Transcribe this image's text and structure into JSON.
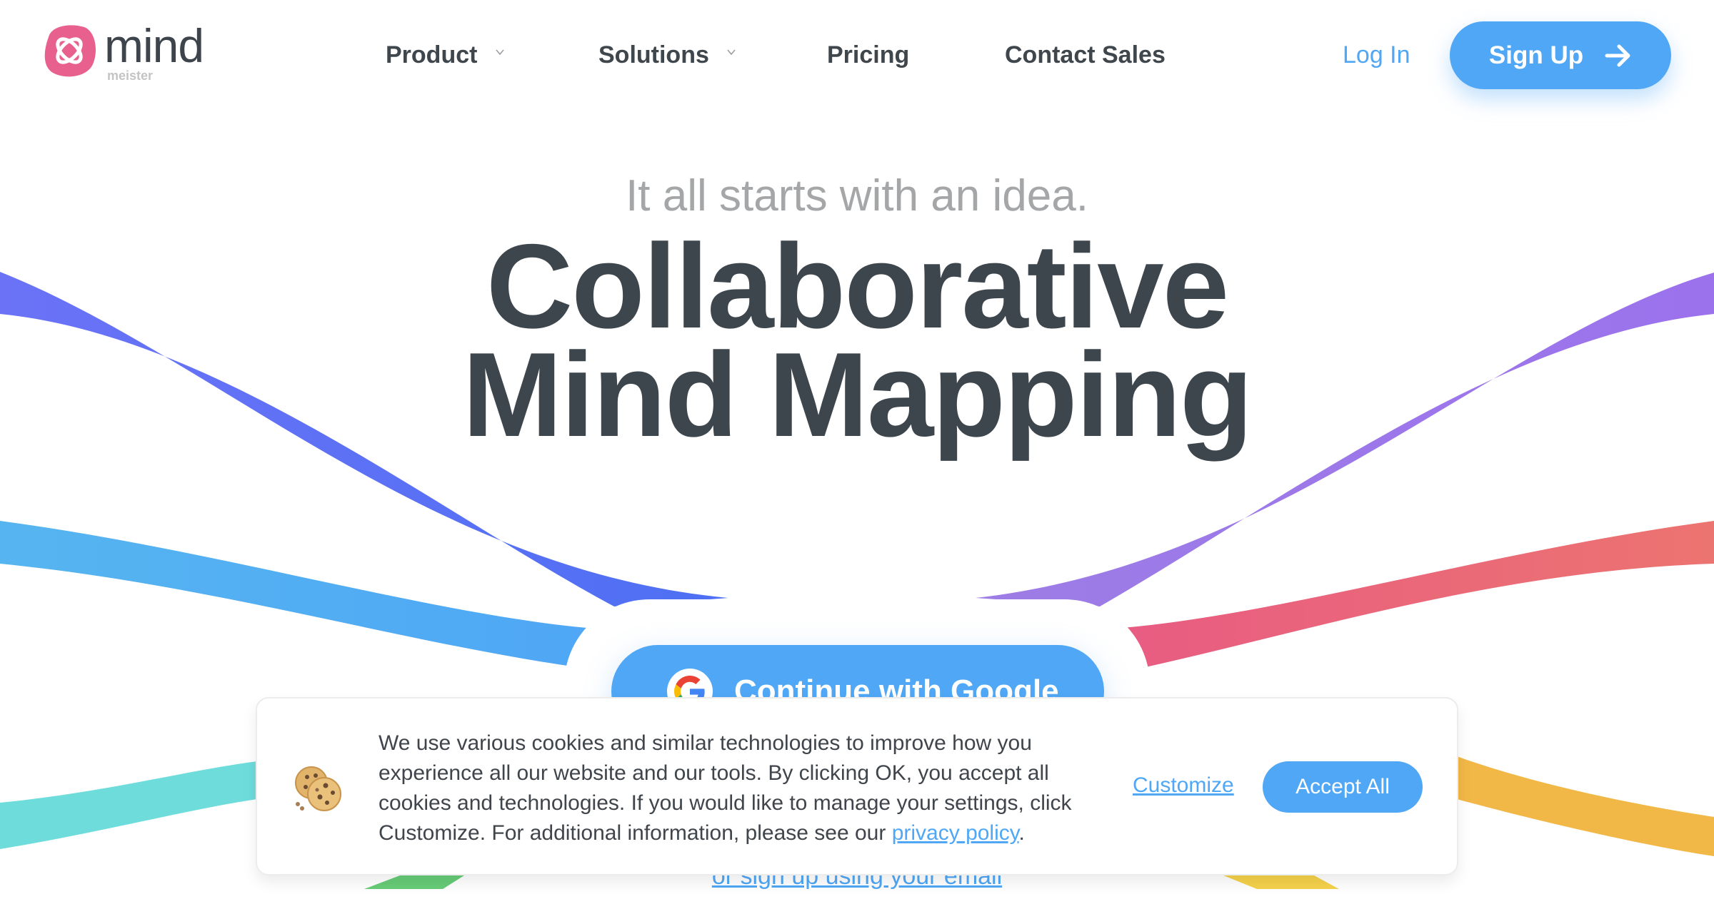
{
  "brand": {
    "name": "mind",
    "sub": "meister",
    "logo_color": "#e8608e"
  },
  "nav": {
    "items": [
      {
        "label": "Product",
        "has_dropdown": true
      },
      {
        "label": "Solutions",
        "has_dropdown": true
      },
      {
        "label": "Pricing",
        "has_dropdown": false
      },
      {
        "label": "Contact Sales",
        "has_dropdown": false
      }
    ],
    "login_label": "Log In",
    "signup_label": "Sign Up",
    "signup_icon": "arrow-right-icon"
  },
  "hero": {
    "tagline": "It all starts with an idea.",
    "headline_line1": "Collaborative",
    "headline_line2": "Mind Mapping",
    "google_button_label": "Continue with Google",
    "google_icon": "google-g-icon",
    "email_link_label": "or sign up using your email"
  },
  "cookie_banner": {
    "icon": "cookie-icon",
    "text_before_link": "We use various cookies and similar technologies to improve how you experience all our website and our tools. By clicking OK, you accept all cookies and technologies. If you would like to manage your settings, click Customize. For additional information, please see our ",
    "link_label": "privacy policy",
    "text_after_link": ".",
    "customize_label": "Customize",
    "accept_label": "Accept All"
  },
  "colors": {
    "accent": "#4fa7f5",
    "text_dark": "#3e464d",
    "tagline_gray": "#a4a6a8",
    "ribbon_indigo": "#5a6ff5",
    "ribbon_sky": "#52adf2",
    "ribbon_purple": "#9b78e8",
    "ribbon_coral": "#ea5f80",
    "ribbon_teal": "#6fdcdc",
    "ribbon_orange": "#f2b847",
    "ribbon_green": "#66cc77",
    "ribbon_yellow": "#f5d24a"
  }
}
